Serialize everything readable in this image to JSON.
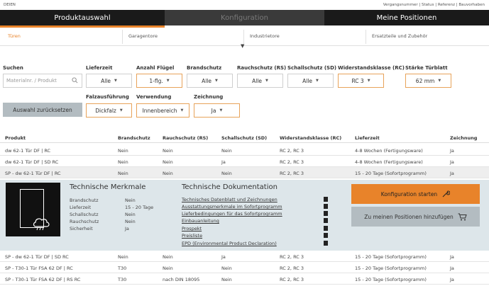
{
  "topbar": {
    "brand": "DEIEN",
    "links": "Vergangsnummer | Status | Referenz | Bauvorhaben"
  },
  "nav": {
    "tabs": [
      "Produktauswahl",
      "Konfiguration",
      "Meine Positionen"
    ]
  },
  "subnav": {
    "items": [
      "Türen",
      "Garagentore",
      "Industrietore",
      "Ersatzteile und Zubehör"
    ]
  },
  "filters": {
    "search_label": "Suchen",
    "search_placeholder": "Materialnr. / Produkt",
    "lieferzeit": {
      "label": "Lieferzeit",
      "value": "Alle"
    },
    "fluegel": {
      "label": "Anzahl Flügel",
      "value": "1-flg."
    },
    "brandschutz": {
      "label": "Brandschutz",
      "value": "Alle"
    },
    "rauchschutz": {
      "label": "Rauchschutz (RS)",
      "value": "Alle"
    },
    "schallschutz": {
      "label": "Schallschutz (SD)",
      "value": "Alle"
    },
    "widerstand": {
      "label": "Widerstandsklasse (RC)",
      "value": "RC 3"
    },
    "staerke": {
      "label": "Stärke Türblatt",
      "value": "62 mm"
    },
    "falz": {
      "label": "Falzausführung",
      "value": "Dickfalz"
    },
    "verwendung": {
      "label": "Verwendung",
      "value": "Innenbereich"
    },
    "zeichnung": {
      "label": "Zeichnung",
      "value": "Ja"
    },
    "reset_label": "Auswahl zurücksetzen"
  },
  "table": {
    "headers": [
      "Produkt",
      "Brandschutz",
      "Rauchschutz (RS)",
      "Schallschutz (SD)",
      "Widerstandsklasse (RC)",
      "Lieferzeit",
      "Zeichnung"
    ],
    "rows_top": [
      [
        "dw 62-1 Tür DF | RC",
        "Nein",
        "Nein",
        "Nein",
        "RC 2, RC 3",
        "4-8 Wochen (Fertigungsware)",
        "Ja"
      ],
      [
        "dw 62-1 Tür DF | SD RC",
        "Nein",
        "Nein",
        "Ja",
        "RC 2, RC 3",
        "4-8 Wochen (Fertigungsware)",
        "Ja"
      ],
      [
        "SP - dw 62-1 Tür DF | RC",
        "Nein",
        "Nein",
        "Nein",
        "RC 2, RC 3",
        "15 - 20 Tage (Sofortprogramm)",
        "Ja"
      ]
    ],
    "rows_bottom": [
      [
        "SP - dw 62-1 Tür DF | SD RC",
        "Nein",
        "Nein",
        "Ja",
        "RC 2, RC 3",
        "15 - 20 Tage (Sofortprogramm)",
        "Ja"
      ],
      [
        "SP - T30-1 Tür FSA 62 DF | RC",
        "T30",
        "Nein",
        "Nein",
        "RC 2, RC 3",
        "15 - 20 Tage (Sofortprogramm)",
        "Ja"
      ],
      [
        "SP - T30-1 Tür FSA 62 DF | RS RC",
        "T30",
        "nach DIN 18095",
        "Nein",
        "RC 2, RC 3",
        "15 - 20 Tage (Sofortprogramm)",
        "Ja"
      ]
    ]
  },
  "detail": {
    "merkmale_title": "Technische Merkmale",
    "merkmale": [
      [
        "Brandschutz",
        "Nein"
      ],
      [
        "Lieferzeit",
        "15 - 20 Tage"
      ],
      [
        "Schallschutz",
        "Nein"
      ],
      [
        "Rauchschutz",
        "Nein"
      ],
      [
        "Sicherheit",
        "Ja"
      ]
    ],
    "doku_title": "Technische Dokumentation",
    "docs": [
      "Technisches Datenblatt und Zeichnungen",
      "Ausstattungsmerkmale im Sofortprogramm",
      "Lieferbedingungen für das Sofortprogramm",
      "Einbauanleitung",
      "Prospekt",
      "Preisliste",
      "EPD (Environmental Product Declaration)"
    ],
    "config_button": "Konfiguration starten",
    "add_button": "Zu meinen Positionen hinzufügen"
  },
  "colors": {
    "accent": "#e8832a",
    "nav_dark": "#1a1a1a",
    "detail_bg": "#dde6ea",
    "button_grey": "#b3bcc1"
  }
}
